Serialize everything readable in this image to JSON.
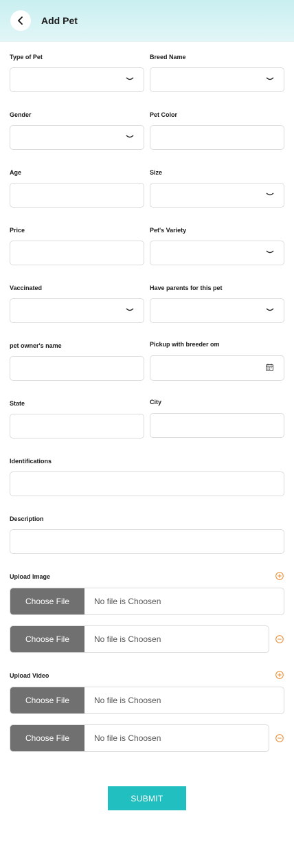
{
  "header": {
    "title": "Add Pet",
    "back_icon": "chevron-left-icon"
  },
  "form": {
    "type_of_pet": {
      "label": "Type of Pet",
      "value": ""
    },
    "breed_name": {
      "label": "Breed Name",
      "value": ""
    },
    "gender": {
      "label": "Gender",
      "value": ""
    },
    "pet_color": {
      "label": "Pet Color",
      "value": ""
    },
    "age": {
      "label": "Age",
      "value": ""
    },
    "size": {
      "label": "Size",
      "value": ""
    },
    "price": {
      "label": "Price",
      "value": ""
    },
    "pet_variety": {
      "label": "Pet's Variety",
      "value": ""
    },
    "vaccinated": {
      "label": "Vaccinated",
      "value": ""
    },
    "have_parents": {
      "label": "Have parents for this pet",
      "value": ""
    },
    "owner_name": {
      "label": "pet owner's name",
      "value": ""
    },
    "pickup_with_breeder": {
      "label": "Pickup with breeder om",
      "value": ""
    },
    "state": {
      "label": "State",
      "value": ""
    },
    "city": {
      "label": "City",
      "value": ""
    },
    "identifications": {
      "label": "Identifications",
      "value": ""
    },
    "description": {
      "label": "Description",
      "value": ""
    }
  },
  "upload_image": {
    "label": "Upload Image",
    "add_icon": "plus-circle-icon",
    "remove_icon": "minus-circle-icon",
    "rows": [
      {
        "button": "Choose File",
        "status": "No file is Choosen"
      },
      {
        "button": "Choose File",
        "status": "No file is Choosen"
      }
    ]
  },
  "upload_video": {
    "label": "Upload Video",
    "add_icon": "plus-circle-icon",
    "remove_icon": "minus-circle-icon",
    "rows": [
      {
        "button": "Choose File",
        "status": "No file is Choosen"
      },
      {
        "button": "Choose File",
        "status": "No file is Choosen"
      }
    ]
  },
  "submit_label": "SUBMIT",
  "colors": {
    "accent": "#22bfc0",
    "orange": "#e8892b",
    "file_button": "#707070",
    "header_gradient_top": "#c9eff0"
  }
}
